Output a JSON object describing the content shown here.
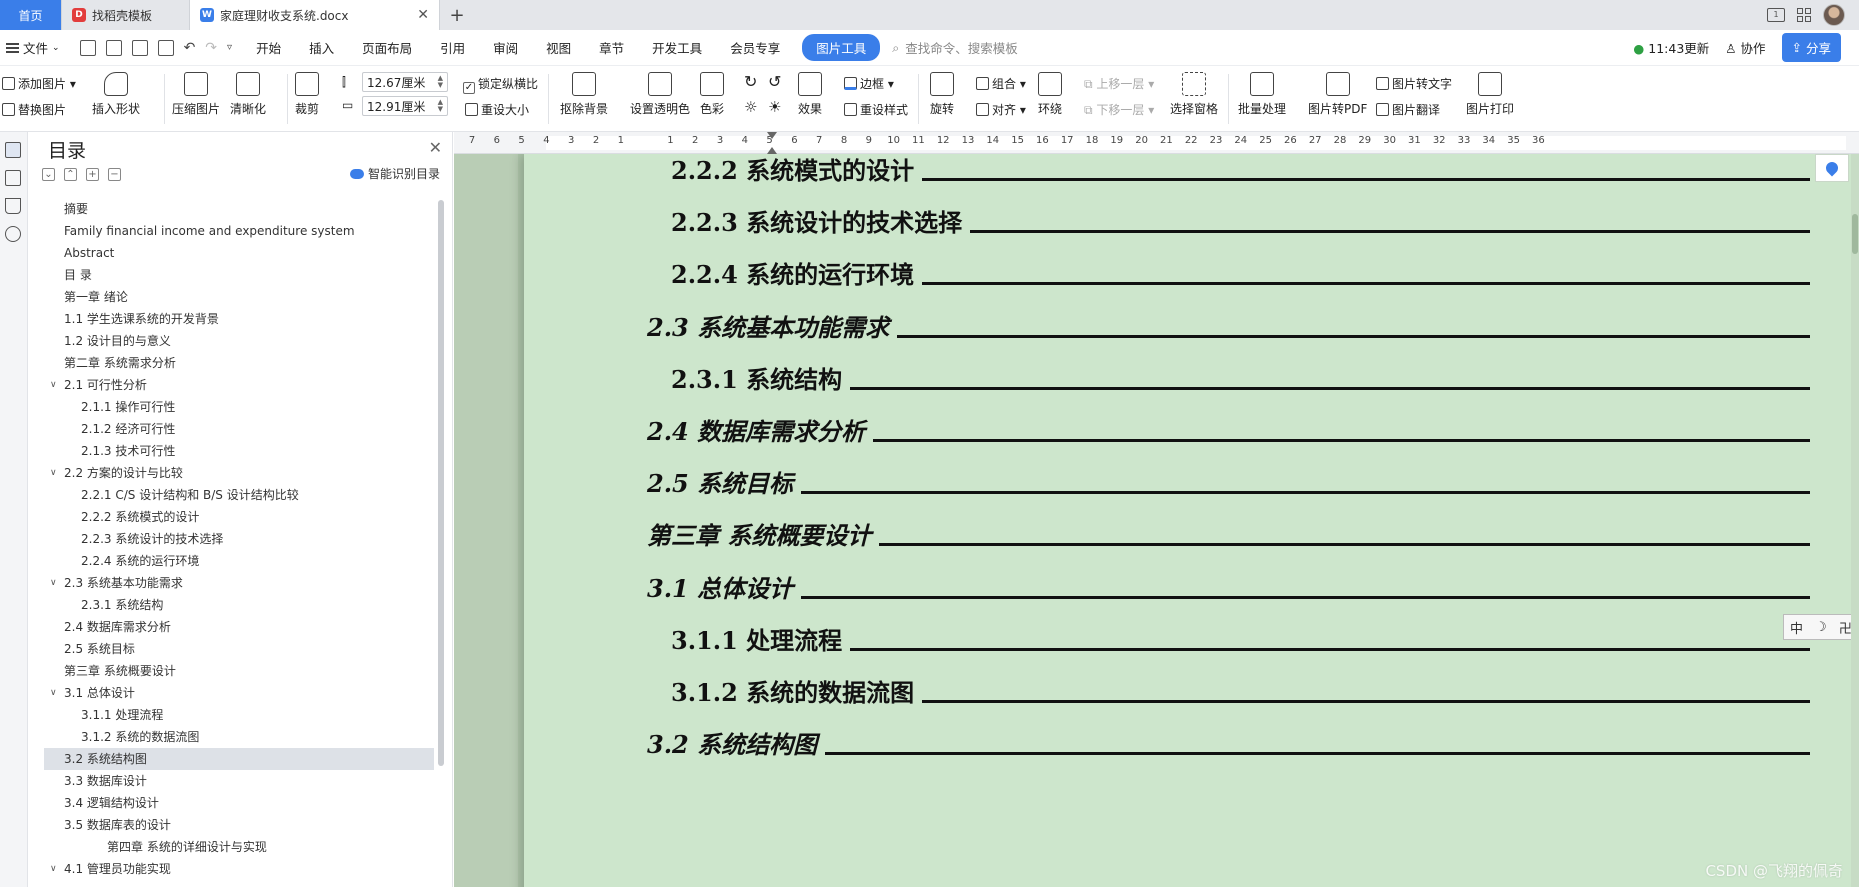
{
  "tabs": {
    "home": "首页",
    "template": "找稻壳模板",
    "doc": "家庭理财收支系统.docx"
  },
  "menu": {
    "file": "文件",
    "items": [
      "开始",
      "插入",
      "页面布局",
      "引用",
      "审阅",
      "视图",
      "章节",
      "开发工具",
      "会员专享"
    ],
    "active": "图片工具",
    "search_placeholder": "查找命令、搜索模板",
    "update": "11:43更新",
    "collab": "协作",
    "share": "分享"
  },
  "ribbon": {
    "add_image": "添加图片",
    "replace_image": "替换图片",
    "insert_shape": "插入形状",
    "compress_image": "压缩图片",
    "clarify": "清晰化",
    "crop": "裁剪",
    "width": "12.67厘米",
    "height": "12.91厘米",
    "lock_ratio": "锁定纵横比",
    "reset_size": "重设大小",
    "remove_bg": "抠除背景",
    "set_transparent": "设置透明色",
    "color": "色彩",
    "effect": "效果",
    "border": "边框",
    "reset_style": "重设样式",
    "rotate": "旋转",
    "group": "组合",
    "align": "对齐",
    "wrap": "环绕",
    "bring_forward": "上移一层",
    "send_backward": "下移一层",
    "selection_pane": "选择窗格",
    "batch": "批量处理",
    "to_pdf": "图片转PDF",
    "to_text": "图片转文字",
    "translate": "图片翻译",
    "print": "图片打印"
  },
  "toc_pane": {
    "title": "目录",
    "smart": "智能识别目录",
    "items": [
      {
        "label": "摘要",
        "level": 1
      },
      {
        "label": "Family financial income and expenditure system",
        "level": 1
      },
      {
        "label": "Abstract",
        "level": 1
      },
      {
        "label": "目    录",
        "level": 1
      },
      {
        "label": "第一章 绪论",
        "level": 1
      },
      {
        "label": "1.1 学生选课系统的开发背景",
        "level": 1
      },
      {
        "label": "1.2 设计目的与意义",
        "level": 1
      },
      {
        "label": "第二章 系统需求分析",
        "level": 1
      },
      {
        "label": "2.1 可行性分析",
        "level": 1,
        "caret": true
      },
      {
        "label": "2.1.1 操作可行性",
        "level": 2
      },
      {
        "label": "2.1.2 经济可行性",
        "level": 2
      },
      {
        "label": "2.1.3 技术可行性",
        "level": 2
      },
      {
        "label": "2.2 方案的设计与比较",
        "level": 1,
        "caret": true
      },
      {
        "label": "2.2.1 C/S 设计结构和 B/S 设计结构比较",
        "level": 2
      },
      {
        "label": "2.2.2 系统模式的设计",
        "level": 2
      },
      {
        "label": "2.2.3 系统设计的技术选择",
        "level": 2
      },
      {
        "label": "2.2.4 系统的运行环境",
        "level": 2
      },
      {
        "label": "2.3 系统基本功能需求",
        "level": 1,
        "caret": true
      },
      {
        "label": "2.3.1 系统结构",
        "level": 2
      },
      {
        "label": "2.4 数据库需求分析",
        "level": 1
      },
      {
        "label": "2.5 系统目标",
        "level": 1
      },
      {
        "label": "第三章 系统概要设计",
        "level": 1
      },
      {
        "label": "3.1 总体设计",
        "level": 1,
        "caret": true
      },
      {
        "label": "3.1.1 处理流程",
        "level": 2
      },
      {
        "label": "3.1.2 系统的数据流图",
        "level": 2
      },
      {
        "label": "3.2 系统结构图",
        "level": 1,
        "selected": true
      },
      {
        "label": "3.3 数据库设计",
        "level": 1
      },
      {
        "label": "3.4 逻辑结构设计",
        "level": 1
      },
      {
        "label": "3.5 数据库表的设计",
        "level": 1
      },
      {
        "label": "第四章 系统的详细设计与实现",
        "level": 3
      },
      {
        "label": "4.1 管理员功能实现",
        "level": 1,
        "caret": true
      }
    ]
  },
  "ruler": {
    "ticks": [
      "7",
      "6",
      "5",
      "4",
      "3",
      "2",
      "1",
      "",
      "1",
      "2",
      "3",
      "4",
      "5",
      "6",
      "7",
      "8",
      "9",
      "10",
      "11",
      "12",
      "13",
      "14",
      "15",
      "16",
      "17",
      "18",
      "19",
      "20",
      "21",
      "22",
      "23",
      "24",
      "25",
      "26",
      "27",
      "28",
      "29",
      "30",
      "31",
      "32",
      "33",
      "34",
      "35",
      "36"
    ]
  },
  "document": {
    "lines": [
      {
        "text": "2.2.2  系统模式的设计",
        "indent": 1,
        "italic": false
      },
      {
        "text": "2.2.3 系统设计的技术选择",
        "indent": 1,
        "italic": false
      },
      {
        "text": "2.2.4 系统的运行环境",
        "indent": 1,
        "italic": false
      },
      {
        "text": "2.3 系统基本功能需求",
        "indent": 0,
        "italic": true
      },
      {
        "text": "2.3.1  系统结构",
        "indent": 1,
        "italic": false
      },
      {
        "text": "2.4 数据库需求分析",
        "indent": 0,
        "italic": true
      },
      {
        "text": "2.5 系统目标",
        "indent": 0,
        "italic": true
      },
      {
        "text": "第三章  系统概要设计",
        "indent": 0,
        "italic": true
      },
      {
        "text": "3.1 总体设计",
        "indent": 0,
        "italic": true
      },
      {
        "text": "3.1.1  处理流程",
        "indent": 1,
        "italic": false
      },
      {
        "text": "3.1.2 系统的数据流图",
        "indent": 1,
        "italic": false
      },
      {
        "text": "3.2 系统结构图",
        "indent": 0,
        "italic": true
      }
    ],
    "ime": [
      "中",
      "☽",
      "卍"
    ],
    "watermark": "CSDN @飞翔的佩奇"
  },
  "colors": {
    "accent": "#3a7ee9",
    "page_bg": "#cde6cc",
    "canvas_bg": "#b9cdb5"
  }
}
